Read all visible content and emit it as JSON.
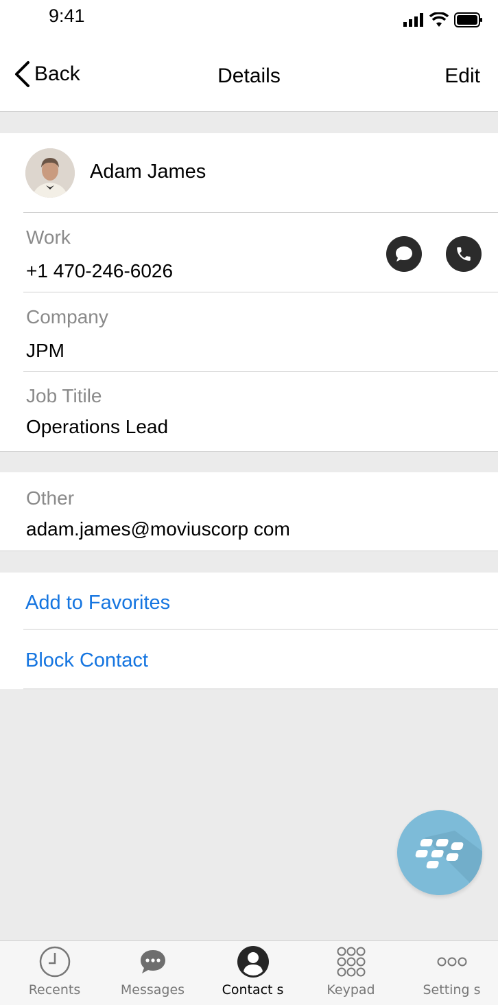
{
  "status_bar": {
    "time": "9:41"
  },
  "nav": {
    "back_label": "Back",
    "title": "Details",
    "edit_label": "Edit"
  },
  "contact": {
    "name": "Adam James",
    "fields": [
      {
        "label": "Work",
        "value": "+1 470-246-6026"
      },
      {
        "label": "Company",
        "value": "JPM"
      },
      {
        "label": "Job Titile",
        "value": "Operations Lead"
      }
    ],
    "other": {
      "label": "Other",
      "value": "adam.james@moviuscorp com"
    }
  },
  "actions": {
    "add_favorites": "Add to Favorites",
    "block_contact": "Block Contact"
  },
  "fab": {
    "icon": "blackberry-icon",
    "color": "#7dbbd8"
  },
  "tabs": [
    {
      "label": "Recents",
      "icon": "clock-icon"
    },
    {
      "label": "Messages",
      "icon": "chat-bubble-icon"
    },
    {
      "label": "Contact s",
      "icon": "person-icon",
      "active": true
    },
    {
      "label": "Keypad",
      "icon": "keypad-icon"
    },
    {
      "label": "Setting s",
      "icon": "more-dots-icon"
    }
  ],
  "colors": {
    "link": "#1575e0",
    "background": "#ebebeb",
    "action_icon_bg": "#2b2b2b"
  }
}
